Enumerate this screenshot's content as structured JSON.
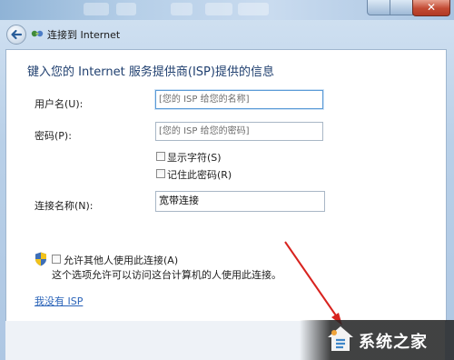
{
  "window": {
    "nav_title": "连接到 Internet",
    "close_glyph": "✕"
  },
  "form": {
    "heading": "键入您的 Internet 服务提供商(ISP)提供的信息",
    "username_label": "用户名(U):",
    "username_placeholder": "[您的 ISP 给您的名称]",
    "password_label": "密码(P):",
    "password_placeholder": "[您的 ISP 给您的密码]",
    "show_chars_label": "显示字符(S)",
    "remember_password_label": "记住此密码(R)",
    "connection_name_label": "连接名称(N):",
    "connection_name_value": "宽带连接",
    "allow_others_label": "允许其他人使用此连接(A)",
    "allow_others_desc": "这个选项允许可以访问这台计算机的人使用此连接。",
    "no_isp_link": "我没有 ISP"
  },
  "watermark": {
    "text": "系统之家"
  },
  "colors": {
    "heading": "#1f3f6f",
    "link": "#2a63b8",
    "arrow": "#d8231f"
  },
  "icons": [
    "back-arrow-icon",
    "network-icon",
    "shield-icon",
    "house-logo-icon"
  ]
}
